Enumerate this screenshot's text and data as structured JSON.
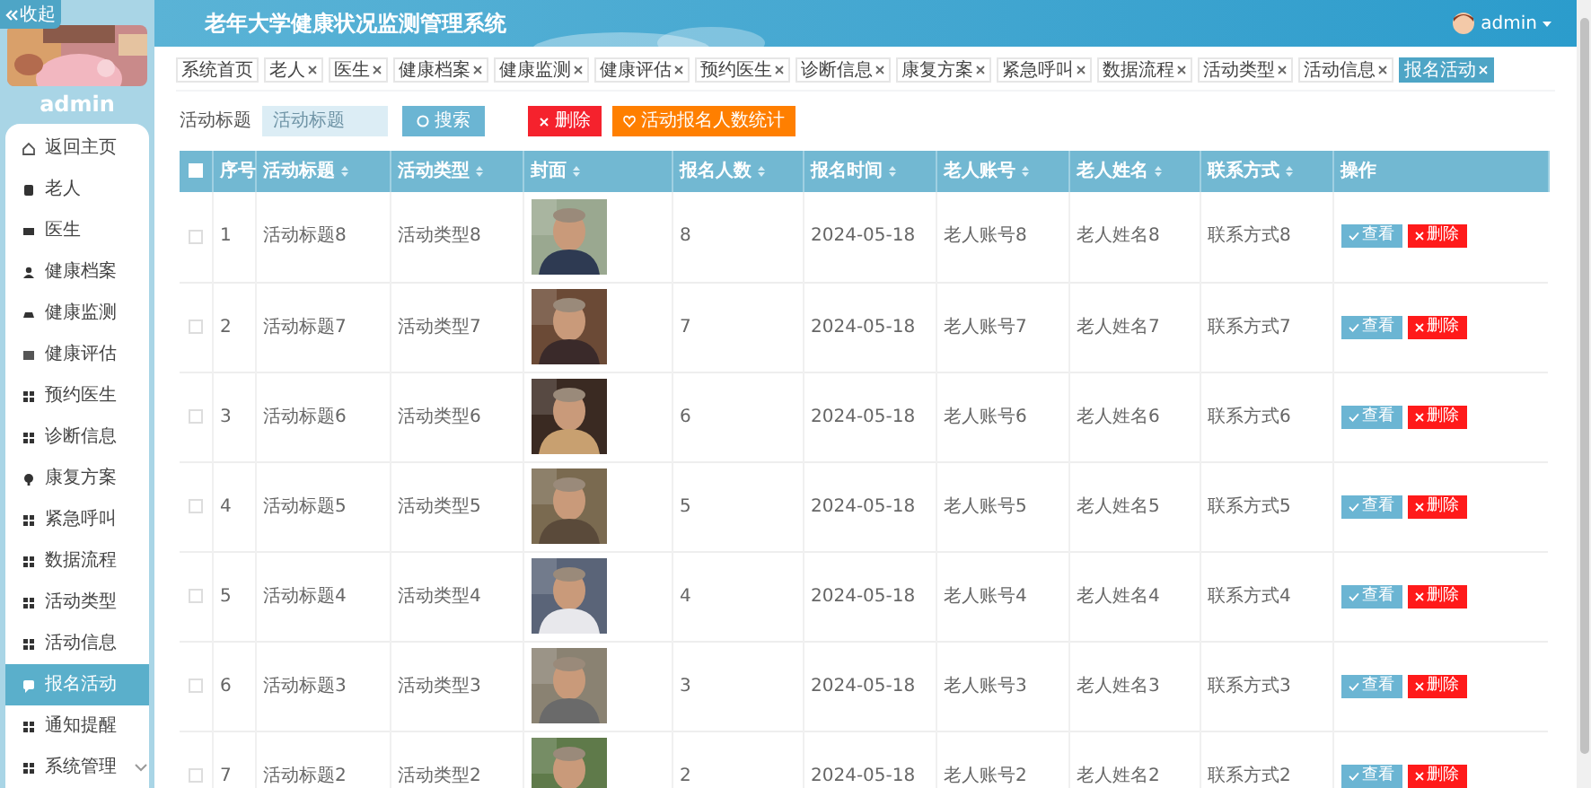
{
  "sidebar": {
    "collapse_button": "收起",
    "user": "admin",
    "items": [
      {
        "label": "返回主页",
        "selected": false
      },
      {
        "label": "老人",
        "selected": false
      },
      {
        "label": "医生",
        "selected": false
      },
      {
        "label": "健康档案",
        "selected": false
      },
      {
        "label": "健康监测",
        "selected": false
      },
      {
        "label": "健康评估",
        "selected": false
      },
      {
        "label": "预约医生",
        "selected": false
      },
      {
        "label": "诊断信息",
        "selected": false
      },
      {
        "label": "康复方案",
        "selected": false
      },
      {
        "label": "紧急呼叫",
        "selected": false
      },
      {
        "label": "数据流程",
        "selected": false
      },
      {
        "label": "活动类型",
        "selected": false
      },
      {
        "label": "活动信息",
        "selected": false
      },
      {
        "label": "报名活动",
        "selected": true
      },
      {
        "label": "通知提醒",
        "selected": false
      },
      {
        "label": "系统管理",
        "selected": false,
        "expandable": true
      }
    ]
  },
  "header": {
    "title": "老年大学健康状况监测管理系统",
    "user": "admin"
  },
  "tabs": [
    {
      "label": "系统首页",
      "selected": false,
      "closable": false
    },
    {
      "label": "老人",
      "selected": false,
      "closable": true
    },
    {
      "label": "医生",
      "selected": false,
      "closable": true
    },
    {
      "label": "健康档案",
      "selected": false,
      "closable": true
    },
    {
      "label": "健康监测",
      "selected": false,
      "closable": true
    },
    {
      "label": "健康评估",
      "selected": false,
      "closable": true
    },
    {
      "label": "预约医生",
      "selected": false,
      "closable": true
    },
    {
      "label": "诊断信息",
      "selected": false,
      "closable": true
    },
    {
      "label": "康复方案",
      "selected": false,
      "closable": true
    },
    {
      "label": "紧急呼叫",
      "selected": false,
      "closable": true
    },
    {
      "label": "数据流程",
      "selected": false,
      "closable": true
    },
    {
      "label": "活动类型",
      "selected": false,
      "closable": true
    },
    {
      "label": "活动信息",
      "selected": false,
      "closable": true
    },
    {
      "label": "报名活动",
      "selected": true,
      "closable": true
    }
  ],
  "search": {
    "label": "活动标题",
    "placeholder": "活动标题",
    "search_button": "搜索",
    "delete_button": "删除",
    "stats_button": "活动报名人数统计"
  },
  "table": {
    "columns": [
      {
        "label": "序号",
        "sortable": false
      },
      {
        "label": "活动标题",
        "sortable": true
      },
      {
        "label": "活动类型",
        "sortable": true
      },
      {
        "label": "封面",
        "sortable": true
      },
      {
        "label": "报名人数",
        "sortable": true
      },
      {
        "label": "报名时间",
        "sortable": true
      },
      {
        "label": "老人账号",
        "sortable": true
      },
      {
        "label": "老人姓名",
        "sortable": true
      },
      {
        "label": "联系方式",
        "sortable": true
      },
      {
        "label": "操作",
        "sortable": false
      }
    ],
    "header_checked": false,
    "rows": [
      {
        "checked": false,
        "no": "1",
        "title": "活动标题8",
        "type": "活动类型8",
        "count": "8",
        "date": "2024-05-18",
        "account": "老人账号8",
        "name": "老人姓名8",
        "contact": "联系方式8",
        "view": "查看",
        "delete": "删除"
      },
      {
        "checked": false,
        "no": "2",
        "title": "活动标题7",
        "type": "活动类型7",
        "count": "7",
        "date": "2024-05-18",
        "account": "老人账号7",
        "name": "老人姓名7",
        "contact": "联系方式7",
        "view": "查看",
        "delete": "删除"
      },
      {
        "checked": false,
        "no": "3",
        "title": "活动标题6",
        "type": "活动类型6",
        "count": "6",
        "date": "2024-05-18",
        "account": "老人账号6",
        "name": "老人姓名6",
        "contact": "联系方式6",
        "view": "查看",
        "delete": "删除"
      },
      {
        "checked": false,
        "no": "4",
        "title": "活动标题5",
        "type": "活动类型5",
        "count": "5",
        "date": "2024-05-18",
        "account": "老人账号5",
        "name": "老人姓名5",
        "contact": "联系方式5",
        "view": "查看",
        "delete": "删除"
      },
      {
        "checked": false,
        "no": "5",
        "title": "活动标题4",
        "type": "活动类型4",
        "count": "4",
        "date": "2024-05-18",
        "account": "老人账号4",
        "name": "老人姓名4",
        "contact": "联系方式4",
        "view": "查看",
        "delete": "删除"
      },
      {
        "checked": false,
        "no": "6",
        "title": "活动标题3",
        "type": "活动类型3",
        "count": "3",
        "date": "2024-05-18",
        "account": "老人账号3",
        "name": "老人姓名3",
        "contact": "联系方式3",
        "view": "查看",
        "delete": "删除"
      },
      {
        "checked": false,
        "no": "7",
        "title": "活动标题2",
        "type": "活动类型2",
        "count": "2",
        "date": "2024-05-18",
        "account": "老人账号2",
        "name": "老人姓名2",
        "contact": "联系方式2",
        "view": "查看",
        "delete": "删除"
      }
    ]
  }
}
